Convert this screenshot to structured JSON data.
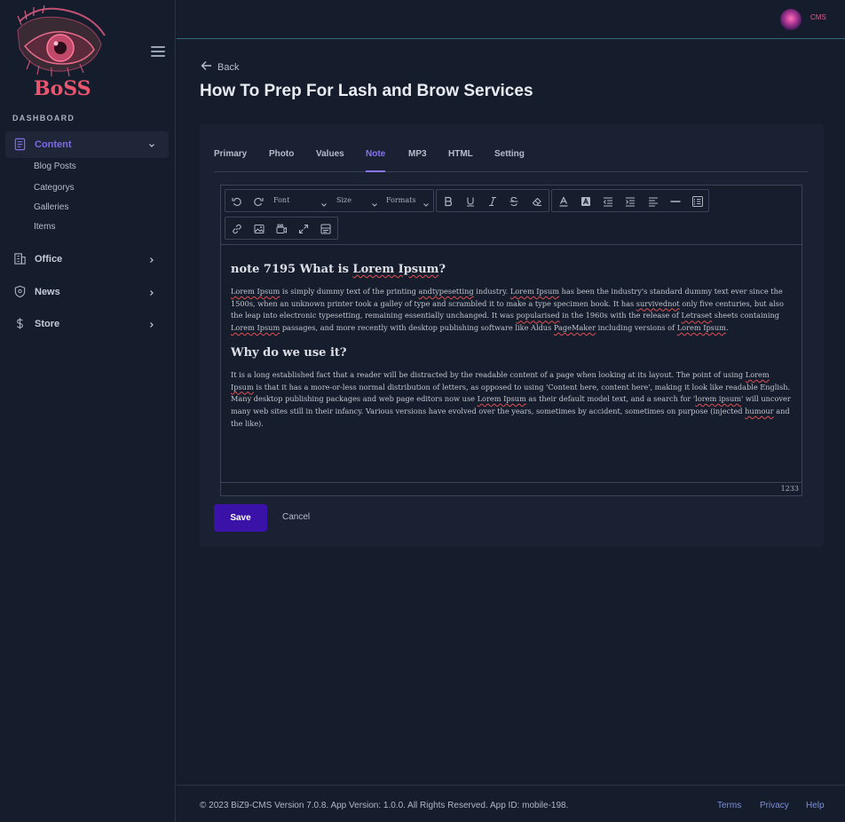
{
  "brand": {
    "logo_text": "BoSS"
  },
  "sidebar": {
    "section_label": "DASHBOARD",
    "active_item": {
      "label": "Content",
      "icon": "document-icon"
    },
    "sub_items": [
      {
        "label": "Blog Posts"
      },
      {
        "label": "Categorys"
      },
      {
        "label": "Galleries"
      },
      {
        "label": "Items"
      }
    ],
    "items": [
      {
        "label": "Office",
        "icon": "building-icon"
      },
      {
        "label": "News",
        "icon": "shield-icon"
      },
      {
        "label": "Store",
        "icon": "dollar-icon"
      }
    ]
  },
  "topbar": {
    "user_label": "CMS"
  },
  "main": {
    "back_label": "Back",
    "title": "How To Prep For Lash and Brow Services",
    "tabs": [
      {
        "label": "Primary"
      },
      {
        "label": "Photo"
      },
      {
        "label": "Values"
      },
      {
        "label": "Note",
        "active": true
      },
      {
        "label": "MP3"
      },
      {
        "label": "HTML"
      },
      {
        "label": "Setting"
      }
    ]
  },
  "editor": {
    "toolbar": {
      "font_label": "Font",
      "size_label": "Size",
      "formats_label": "Formats"
    },
    "heading1": "note 7195 What is Lorem Ipsum?",
    "paragraph1": "Lorem Ipsum is simply dummy text of the printing andtypesetting industry. Lorem Ipsum has been the industry's standard dummy text ever since the 1500s, when an unknown printer took a galley of type and scrambled it to make a type specimen book. It has survivednot only five centuries, but also the leap into electronic typesetting, remaining essentially unchanged. It was popularised in the 1960s with the release of Letraset sheets containing Lorem Ipsum passages, and more recently with desktop publishing software like Aldus PageMaker including versions of Lorem Ipsum.",
    "heading2": "Why do we use it?",
    "paragraph2": "It is a long established fact that a reader will be distracted by the readable content of a page when looking at its layout. The point of using Lorem Ipsum is that it has a more-or-less normal distribution of letters, as opposed to using 'Content here, content here', making it look like readable English. Many desktop publishing packages and web page editors now use Lorem Ipsum as their default model text, and a search for 'lorem ipsum' will uncover many web sites still in their infancy. Various versions have evolved over the years, sometimes by accident, sometimes on purpose (injected humour and the like).",
    "word_count": "1233"
  },
  "actions": {
    "save_label": "Save",
    "cancel_label": "Cancel"
  },
  "footer": {
    "copyright": "© 2023 BiZ9-CMS Version 7.0.8. App Version: 1.0.0. All Rights Reserved. App ID: mobile-198.",
    "links": [
      {
        "label": "Terms"
      },
      {
        "label": "Privacy"
      },
      {
        "label": "Help"
      }
    ]
  },
  "colors": {
    "accent": "#8b74f0",
    "primary_button": "#3b12a8",
    "brand_pink": "#e6578e"
  }
}
